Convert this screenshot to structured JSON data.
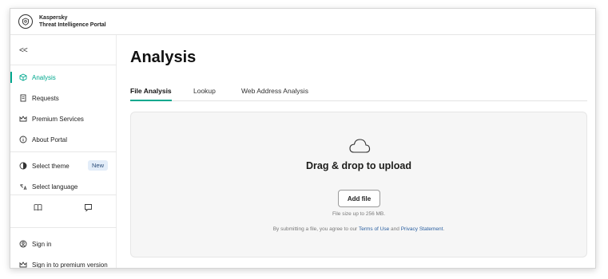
{
  "brand": {
    "line1": "Kaspersky",
    "line2": "Threat Intelligence Portal"
  },
  "sidebar": {
    "collapse_glyph": "<<",
    "items": [
      {
        "label": "Analysis",
        "icon": "cube-icon"
      },
      {
        "label": "Requests",
        "icon": "document-icon"
      },
      {
        "label": "Premium Services",
        "icon": "crown-icon"
      },
      {
        "label": "About Portal",
        "icon": "info-icon"
      }
    ],
    "theme": {
      "label": "Select theme",
      "badge": "New"
    },
    "language": {
      "label": "Select language"
    },
    "bottom": [
      {
        "label": "Sign in",
        "icon": "user-icon"
      },
      {
        "label": "Sign in to premium version",
        "icon": "crown-icon"
      }
    ]
  },
  "main": {
    "title": "Analysis",
    "tabs": [
      {
        "label": "File Analysis",
        "active": true
      },
      {
        "label": "Lookup",
        "active": false
      },
      {
        "label": "Web Address Analysis",
        "active": false
      }
    ],
    "upload": {
      "title": "Drag & drop to upload",
      "button": "Add file",
      "size_note": "File size up to 256 MB.",
      "terms_prefix": "By submitting a file, you agree to our",
      "terms_link": "Terms of Use",
      "terms_and": "and",
      "privacy_link": "Privacy Statement",
      "terms_suffix": "."
    }
  },
  "colors": {
    "accent": "#00a88e",
    "link": "#2a5fa0",
    "badge_bg": "#e3edf9"
  }
}
